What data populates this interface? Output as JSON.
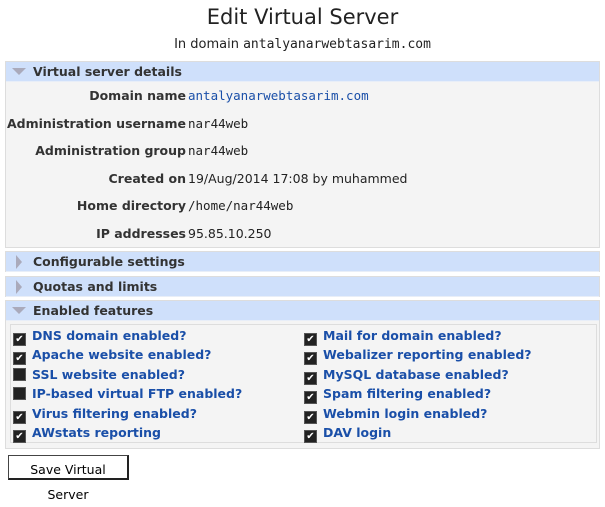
{
  "title": "Edit Virtual Server",
  "subtitle_prefix": "In domain ",
  "subtitle_domain": "antalyanarwebtasarim.com",
  "details": {
    "header": "Virtual server details",
    "rows": [
      {
        "label": "Domain name",
        "value": "antalyanarwebtasarim.com"
      },
      {
        "label": "Administration username",
        "value": "nar44web"
      },
      {
        "label": "Administration group",
        "value": "nar44web"
      },
      {
        "label": "Created on",
        "value": "19/Aug/2014 17:08 by muhammed"
      },
      {
        "label": "Home directory",
        "value": "/home/nar44web"
      },
      {
        "label": "IP addresses",
        "value": "95.85.10.250"
      }
    ]
  },
  "configurable": {
    "header": "Configurable settings"
  },
  "quotas": {
    "header": "Quotas and limits"
  },
  "features": {
    "header": "Enabled features",
    "items": [
      {
        "label": "DNS domain enabled?",
        "checked": true
      },
      {
        "label": "Mail for domain enabled?",
        "checked": true
      },
      {
        "label": "Apache website enabled?",
        "checked": true
      },
      {
        "label": "Webalizer reporting enabled?",
        "checked": true
      },
      {
        "label": "SSL website enabled?",
        "checked": false
      },
      {
        "label": "MySQL database enabled?",
        "checked": true
      },
      {
        "label": "IP-based virtual FTP enabled?",
        "checked": false
      },
      {
        "label": "Spam filtering enabled?",
        "checked": true
      },
      {
        "label": "Virus filtering enabled?",
        "checked": true
      },
      {
        "label": "Webmin login enabled?",
        "checked": true
      },
      {
        "label": "AWstats reporting",
        "checked": true
      },
      {
        "label": "DAV login",
        "checked": true
      }
    ]
  },
  "save_label": "Save Virtual Server"
}
